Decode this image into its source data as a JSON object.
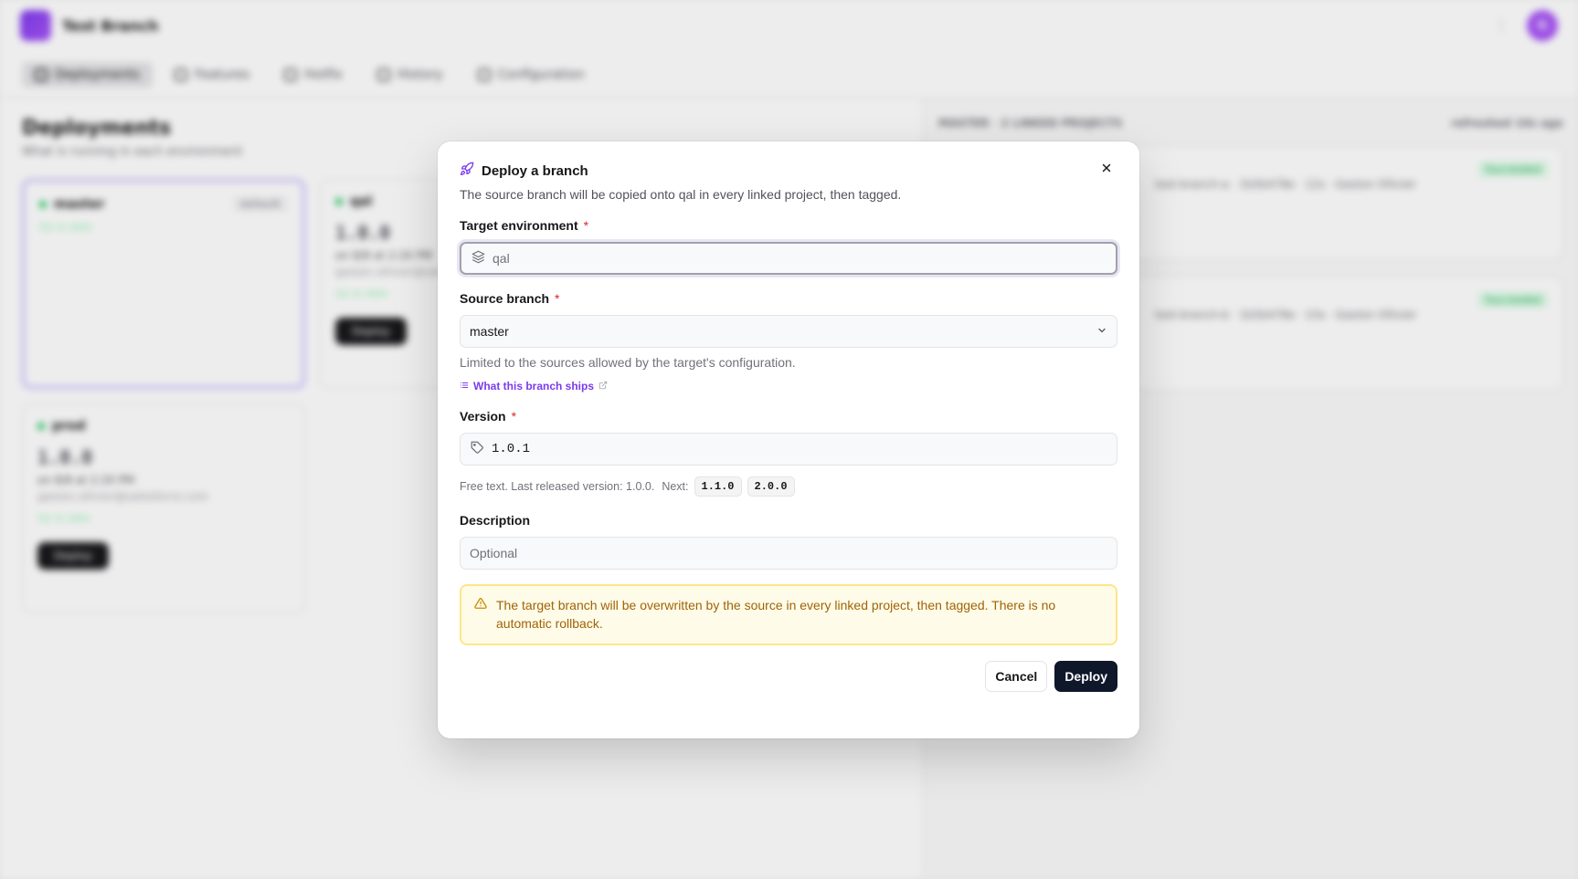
{
  "app": {
    "title": "Test Branch",
    "avatar_initial": "G"
  },
  "nav": {
    "tabs": [
      {
        "label": "Deployments"
      },
      {
        "label": "Features"
      },
      {
        "label": "Hotfix"
      },
      {
        "label": "History"
      },
      {
        "label": "Configuration"
      }
    ]
  },
  "page": {
    "title": "Deployments",
    "subtitle": "What is running in each environment"
  },
  "cards": [
    {
      "name": "master",
      "badge": "default",
      "status": "Up to date",
      "version": "",
      "meta": "",
      "email": "",
      "action": ""
    },
    {
      "name": "qal",
      "badge": "",
      "status": "Up to date",
      "version": "1.0.0",
      "meta": "on 8/8 at 2:20 PM",
      "email": "gaston.ollivier@salesforce.com",
      "action": "Deploy"
    },
    {
      "name": "prod",
      "badge": "",
      "status": "Up to date",
      "version": "1.0.0",
      "meta": "on 8/8 at 2:20 PM",
      "email": "gaston.ollivier@salesforce.com",
      "action": "Deploy"
    }
  ],
  "right_panel": {
    "heading": "MASTER · 2 LINKED PROJECTS",
    "updated": "refreshed 10s ago",
    "runs": [
      {
        "badge": "Succeeded",
        "line": "test-branch-a · 1b5b478e · 12s · Gaston Ollivier"
      },
      {
        "badge": "Succeeded",
        "line": "test-branch-b · 1b5b478e · 23s · Gaston Ollivier"
      }
    ]
  },
  "modal": {
    "title": "Deploy a branch",
    "description": "The source branch will be copied onto qal in every linked project, then tagged.",
    "target_env": {
      "label": "Target environment",
      "required": "*",
      "value": "qal"
    },
    "source_branch": {
      "label": "Source branch",
      "required": "*",
      "value": "master",
      "hint": "Limited to the sources allowed by the target's configuration."
    },
    "link_label": "What this branch ships",
    "version": {
      "label": "Version",
      "required": "*",
      "value": "1.0.1",
      "hint": "Free text. Last released version: 1.0.0.",
      "next_label": "Next:",
      "suggestions": [
        "1.1.0",
        "2.0.0"
      ]
    },
    "description_field": {
      "label": "Description",
      "placeholder": "Optional"
    },
    "warning": "The target branch will be overwritten by the source in every linked project, then tagged. There is no automatic rollback.",
    "cancel_label": "Cancel",
    "deploy_label": "Deploy"
  },
  "icons": {
    "rocket": "rocket-icon",
    "close": "close-icon",
    "layers": "layers-icon",
    "tag": "tag-icon",
    "chevron": "chevron-down-icon",
    "list": "list-icon",
    "external": "external-link-icon",
    "warning": "warning-icon"
  },
  "colors": {
    "accent": "#7c3aed",
    "warning_text": "#a16207",
    "warning_bg": "#fefce8",
    "warning_border": "#fde68a",
    "deploy_button": "#0f172a",
    "required": "#dc2626"
  }
}
